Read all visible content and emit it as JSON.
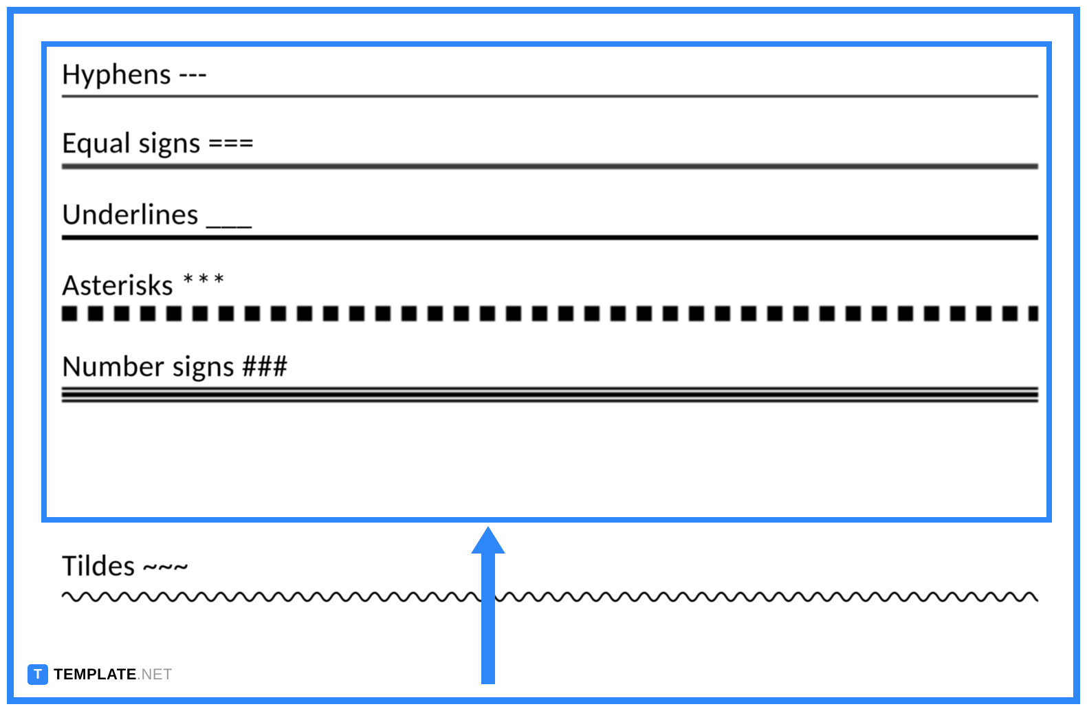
{
  "rows": {
    "hyphens": {
      "label": "Hyphens ---"
    },
    "equals": {
      "label": "Equal signs ==="
    },
    "underlines": {
      "label": "Underlines ___"
    },
    "asterisks": {
      "label": "Asterisks ***"
    },
    "numbers": {
      "label": "Number signs ###"
    },
    "tildes": {
      "label": "Tildes ~~~"
    }
  },
  "watermark": {
    "icon_letter": "T",
    "brand_bold": "TEMPLATE",
    "brand_light": ".NET"
  }
}
